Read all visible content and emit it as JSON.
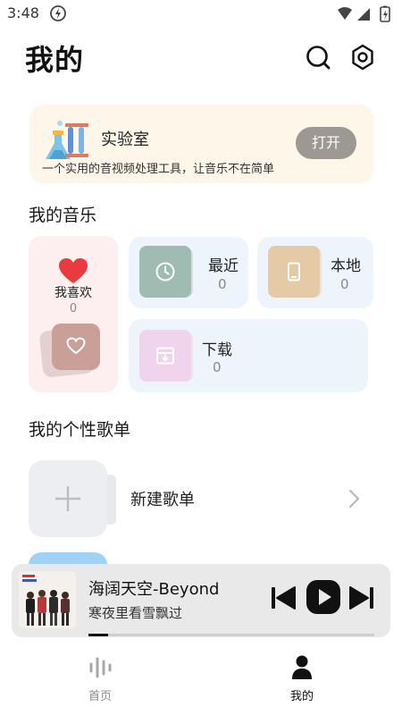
{
  "status_bar": {
    "time": "3:48"
  },
  "header": {
    "title": "我的"
  },
  "lab": {
    "title": "实验室",
    "description": "一个实用的音视频处理工具，让音乐不在简单",
    "open_label": "打开"
  },
  "my_music": {
    "section_title": "我的音乐",
    "favorites": {
      "label": "我喜欢",
      "count": "0"
    },
    "recent": {
      "label": "最近",
      "count": "0"
    },
    "local": {
      "label": "本地",
      "count": "0"
    },
    "downloads": {
      "label": "下载",
      "count": "0"
    }
  },
  "playlists": {
    "section_title": "我的个性歌单",
    "new_playlist_label": "新建歌单"
  },
  "player": {
    "song_title": "海阔天空-Beyond",
    "current_line": "寒夜里看雪飘过",
    "progress": 0.07
  },
  "bottom_nav": {
    "home_label": "首页",
    "mine_label": "我的"
  },
  "colors": {
    "accent_heart": "#e83a3f",
    "lab_bg": "#fff6ea",
    "recent_icon": "#9fbcb3",
    "local_icon": "#e4cba5",
    "download_icon": "#f0d3ec"
  }
}
